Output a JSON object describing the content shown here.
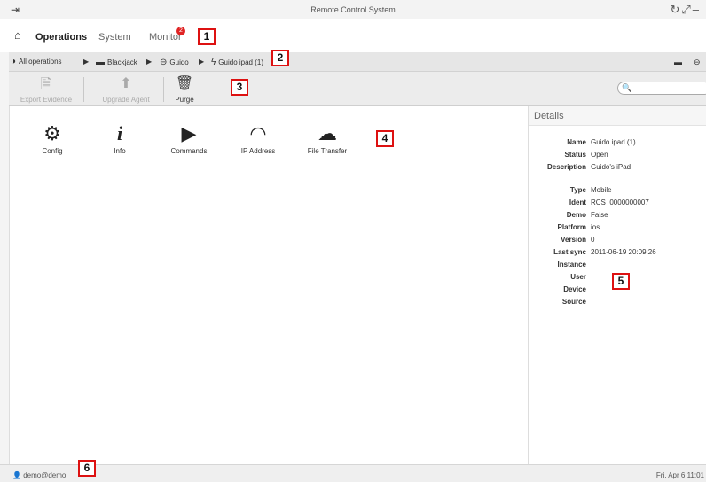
{
  "window": {
    "title": "Remote Control System",
    "exit_icon": "exit-icon",
    "controls_icon": "window-controls-icon"
  },
  "nav": {
    "tabs": [
      {
        "label": "Operations"
      },
      {
        "label": "System"
      },
      {
        "label": "Monitor"
      }
    ],
    "monitor_badge": "2"
  },
  "breadcrumb": {
    "items": [
      {
        "label": "All operations",
        "icon": "globe-icon"
      },
      {
        "label": "Blackjack",
        "icon": "folder-icon"
      },
      {
        "label": "Guido",
        "icon": "target-icon"
      },
      {
        "label": "Guido ipad (1)",
        "icon": "bolt-icon"
      }
    ]
  },
  "toolbar": {
    "export_label": "Export Evidence",
    "upgrade_label": "Upgrade Agent",
    "purge_label": "Purge",
    "search_placeholder": ""
  },
  "modules": [
    {
      "label": "Config",
      "icon": "gears-icon"
    },
    {
      "label": "Info",
      "icon": "info-icon"
    },
    {
      "label": "Commands",
      "icon": "play-icon"
    },
    {
      "label": "IP Address",
      "icon": "wifi-icon"
    },
    {
      "label": "File Transfer",
      "icon": "cloud-transfer-icon"
    }
  ],
  "details": {
    "header": "Details",
    "rows": [
      {
        "key": "Name",
        "value": "Guido ipad (1)"
      },
      {
        "key": "Status",
        "value": "Open"
      },
      {
        "key": "Description",
        "value": "Guido's iPad"
      },
      {
        "key": "Type",
        "value": "Mobile"
      },
      {
        "key": "Ident",
        "value": "RCS_0000000007"
      },
      {
        "key": "Demo",
        "value": "False"
      },
      {
        "key": "Platform",
        "value": "ios"
      },
      {
        "key": "Version",
        "value": "0"
      },
      {
        "key": "Last sync",
        "value": "2011-06-19 20:09:26"
      },
      {
        "key": "Instance",
        "value": ""
      },
      {
        "key": "User",
        "value": ""
      },
      {
        "key": "Device",
        "value": ""
      },
      {
        "key": "Source",
        "value": ""
      }
    ]
  },
  "status": {
    "user": "demo@demo",
    "clock": "Fri, Apr 6  11:01"
  },
  "callouts": [
    "1",
    "2",
    "3",
    "4",
    "5",
    "6"
  ],
  "colors": {
    "badge": "#e02424",
    "callout_border": "#dd1111"
  }
}
